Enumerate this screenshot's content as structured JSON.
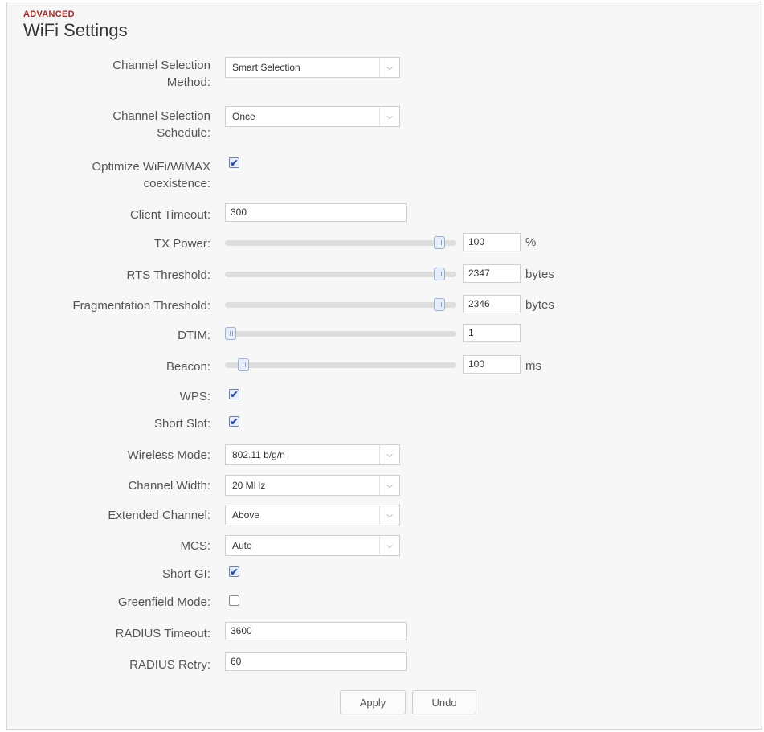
{
  "header": {
    "section": "ADVANCED",
    "title": "WiFi Settings"
  },
  "fields": {
    "channel_method": {
      "label_1": "Channel Selection",
      "label_2": "Method:",
      "value": "Smart Selection"
    },
    "channel_schedule": {
      "label_1": "Channel Selection",
      "label_2": "Schedule:",
      "value": "Once"
    },
    "optimize": {
      "label_1": "Optimize WiFi/WiMAX",
      "label_2": "coexistence:",
      "checked": true
    },
    "client_timeout": {
      "label": "Client Timeout:",
      "value": "300"
    },
    "tx_power": {
      "label": "TX Power:",
      "value": "100",
      "unit": "%",
      "slider_fraction": 0.95
    },
    "rts_threshold": {
      "label": "RTS Threshold:",
      "value": "2347",
      "unit": "bytes",
      "slider_fraction": 0.95
    },
    "frag_threshold": {
      "label": "Fragmentation Threshold:",
      "value": "2346",
      "unit": "bytes",
      "slider_fraction": 0.95
    },
    "dtim": {
      "label": "DTIM:",
      "value": "1",
      "slider_fraction": 0.0
    },
    "beacon": {
      "label": "Beacon:",
      "value": "100",
      "unit": "ms",
      "slider_fraction": 0.06
    },
    "wps": {
      "label": "WPS:",
      "checked": true
    },
    "short_slot": {
      "label": "Short Slot:",
      "checked": true
    },
    "wireless_mode": {
      "label": "Wireless Mode:",
      "value": "802.11 b/g/n"
    },
    "channel_width": {
      "label": "Channel Width:",
      "value": "20 MHz"
    },
    "extended_channel": {
      "label": "Extended Channel:",
      "value": "Above"
    },
    "mcs": {
      "label": "MCS:",
      "value": "Auto"
    },
    "short_gi": {
      "label": "Short GI:",
      "checked": true
    },
    "greenfield": {
      "label": "Greenfield Mode:",
      "checked": false
    },
    "radius_timeout": {
      "label": "RADIUS Timeout:",
      "value": "3600"
    },
    "radius_retry": {
      "label": "RADIUS Retry:",
      "value": "60"
    }
  },
  "buttons": {
    "apply": "Apply",
    "undo": "Undo"
  },
  "icons": {
    "checkmark": "✔",
    "dropdown": "chevron-down-icon"
  },
  "colors": {
    "section_label": "#a32a2a",
    "checkbox": "#2b4f9e",
    "panel_bg": "#f7f7f7"
  }
}
